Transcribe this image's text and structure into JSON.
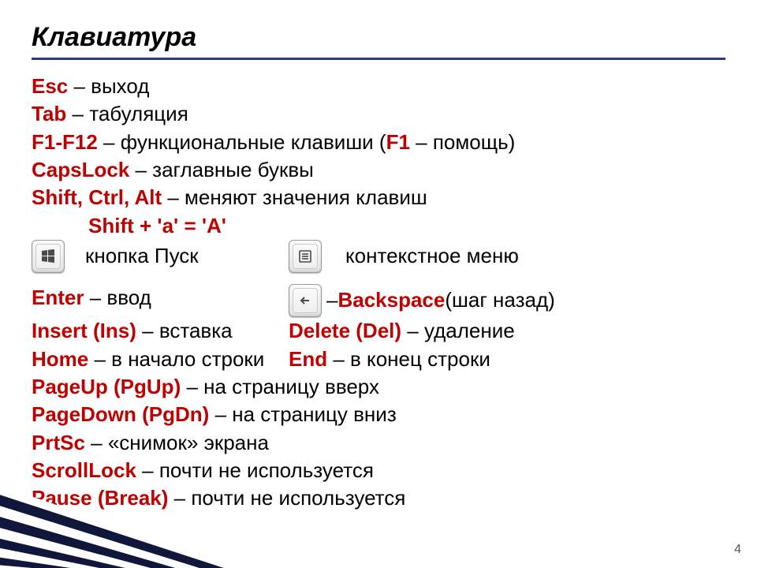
{
  "title": "Клавиатура",
  "page_number": "4",
  "lines": {
    "esc_key": "Esc",
    "esc_desc": " – выход",
    "tab_key": "Tab",
    "tab_desc": " – табуляция",
    "f_key": "F1-F12",
    "f_desc1": " – функциональные клавиши (",
    "f_f1": "F1",
    "f_desc2": " – помощь)",
    "caps_key": "CapsLock",
    "caps_desc": " – заглавные буквы",
    "mods_key": "Shift, Ctrl, Alt",
    "mods_desc": " – меняют значения клавиш",
    "shift_example": "Shift + 'a' = 'A'",
    "start_desc": "кнопка Пуск",
    "context_desc": "контекстное меню",
    "enter_key": "Enter",
    "enter_desc": " – ввод",
    "bksp_dash": " – ",
    "bksp_key": "Backspace",
    "bksp_desc": " (шаг назад)",
    "ins_key": "Insert (Ins)",
    "ins_desc": " – вставка",
    "del_key": "Delete (Del)",
    "del_desc": " – удаление",
    "home_key": "Home",
    "home_desc": " – в начало строки",
    "end_key": "End",
    "end_desc": " – в конец строки",
    "pgup_key": "PageUp (PgUp)",
    "pgup_desc": " – на страницу вверх",
    "pgdn_key": "PageDown (PgDn)",
    "pgdn_desc": " – на страницу вниз",
    "prtsc_key": "PrtSc",
    "prtsc_desc": " – «снимок» экрана",
    "scroll_key": "ScrollLock",
    "scroll_desc": " – почти не используется",
    "pause_key": "Pause (Break)",
    "pause_desc": " – почти не используется"
  },
  "icons": {
    "windows": "windows-key-icon",
    "context": "context-menu-key-icon",
    "backspace": "backspace-key-icon"
  }
}
